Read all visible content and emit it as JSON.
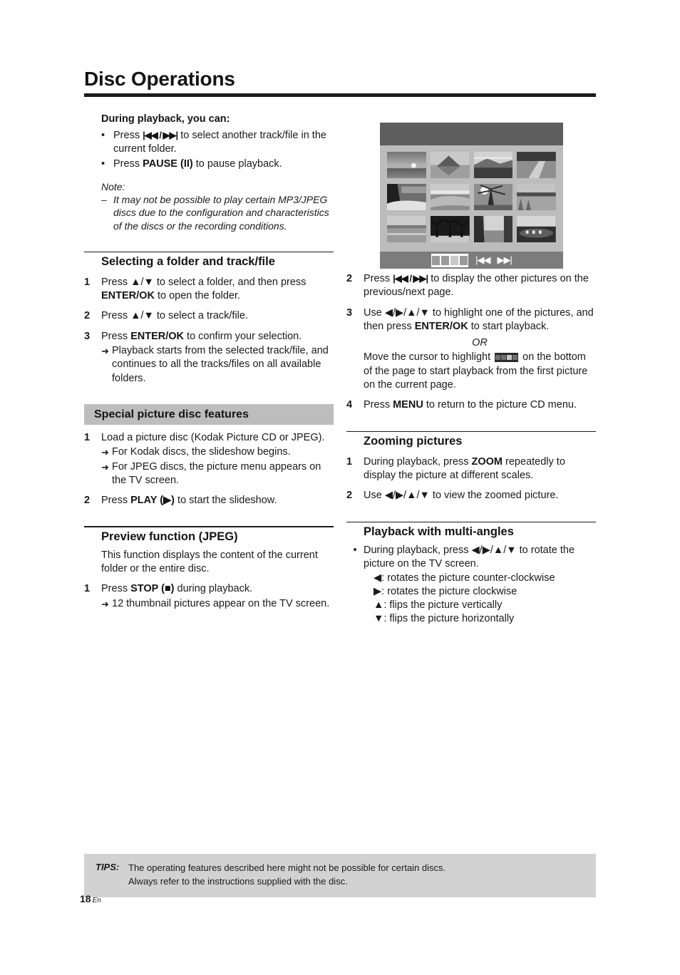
{
  "document": {
    "title": "Disc Operations",
    "page_number": "18",
    "language_code": "En"
  },
  "left_column": {
    "intro": {
      "heading": "During playback, you can:",
      "bullets": [
        {
          "prefix": "Press ",
          "glyph": "|◀◀ / ▶▶|",
          "suffix": " to select another track/file in the current folder."
        },
        {
          "prefix": "Press ",
          "bold": "PAUSE (II)",
          "suffix": " to pause playback."
        }
      ],
      "note_label": "Note:",
      "note_text": "It may not be possible to play certain MP3/JPEG discs due to the configuration and characteristics of the discs or the recording conditions."
    },
    "section_selecting": {
      "title": "Selecting a folder and track/file",
      "steps": [
        {
          "num": "1",
          "text_a": "Press ▲/▼ to select a folder, and then press ",
          "bold": "ENTER/OK",
          "text_b": " to open the folder."
        },
        {
          "num": "2",
          "text_a": "Press ▲/▼ to select a track/file.",
          "bold": "",
          "text_b": ""
        },
        {
          "num": "3",
          "text_a": "Press ",
          "bold": "ENTER/OK",
          "text_b": " to confirm your selection.",
          "arrow": "Playback starts from the selected track/file, and continues to all the tracks/files on all available folders."
        }
      ]
    },
    "section_special": {
      "band_title": "Special picture disc features",
      "steps": [
        {
          "num": "1",
          "text": "Load a picture disc (Kodak Picture CD or JPEG).",
          "arrows": [
            "For Kodak discs, the slideshow begins.",
            "For JPEG discs, the picture menu appears on the TV screen."
          ]
        },
        {
          "num": "2",
          "text_a": "Press ",
          "bold": "PLAY (▶)",
          "text_b": " to start the slideshow."
        }
      ]
    },
    "section_preview": {
      "title": "Preview function (JPEG)",
      "intro": "This function displays the content of the current folder or the entire disc.",
      "step": {
        "num": "1",
        "text_a": "Press ",
        "bold": "STOP (■)",
        "text_b": " during playback.",
        "arrow": "12 thumbnail pictures appear on the TV screen."
      }
    }
  },
  "right_column": {
    "tv_screen": {
      "caption": "picture-cd-thumbnail-menu",
      "header_color": "#5e5e5e",
      "body_color": "#bcbcbc",
      "footer_color": "#7c7c7c",
      "thumbnail_count": 12,
      "footer_controls": {
        "filmstrip_cells": 4,
        "prev_glyph": "|◀◀",
        "next_glyph": "▶▶|"
      }
    },
    "steps": [
      {
        "num": "2",
        "text_a": "Press ",
        "glyph": "|◀◀ / ▶▶|",
        "text_b": " to display the other pictures on the previous/next page."
      },
      {
        "num": "3",
        "text_a": "Use ◀/▶/▲/▼ to highlight one of the pictures, and then press ",
        "bold": "ENTER/OK",
        "text_b": " to start playback.",
        "or_label": "OR",
        "or_text_a": "Move the cursor to highlight ",
        "or_text_b": " on the bottom of the page to start playback from the first picture on the current page."
      },
      {
        "num": "4",
        "text_a": "Press ",
        "bold": "MENU",
        "text_b": " to return to the picture CD menu."
      }
    ],
    "section_zooming": {
      "title": "Zooming pictures",
      "steps": [
        {
          "num": "1",
          "text_a": "During playback, press ",
          "bold": "ZOOM",
          "text_b": " repeatedly to display the picture at different scales."
        },
        {
          "num": "2",
          "text_a": "Use ◀/▶/▲/▼ to view the zoomed picture.",
          "bold": "",
          "text_b": ""
        }
      ]
    },
    "section_multiangle": {
      "title": "Playback with multi-angles",
      "bullet": "During playback, press ◀/▶/▲/▼ to rotate the picture on the TV screen.",
      "sub_lines": [
        "◀: rotates the picture counter-clockwise",
        "▶: rotates the picture clockwise",
        "▲: flips the picture vertically",
        "▼: flips the picture horizontally"
      ]
    }
  },
  "footer": {
    "tips_label": "TIPS:",
    "tips_lines": [
      "The operating features described here might not be possible for certain discs.",
      "Always refer to the instructions supplied with the disc."
    ]
  }
}
